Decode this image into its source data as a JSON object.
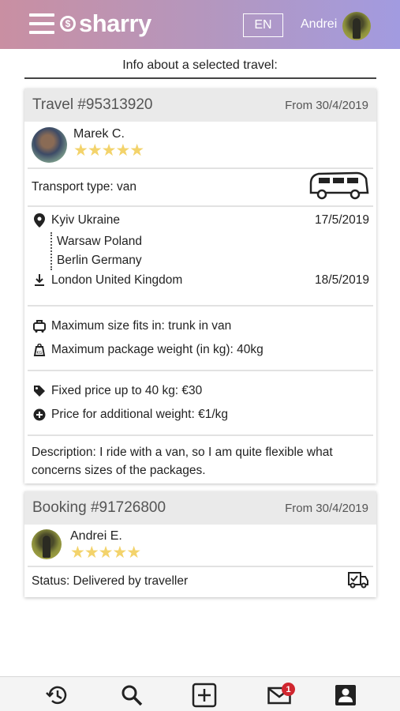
{
  "header": {
    "logo_text": "sharry",
    "lang": "EN",
    "user_name": "Andrei",
    "menu_icon": "hamburger-icon"
  },
  "subtitle": "Info about a selected travel:",
  "travel": {
    "title": "Travel #95313920",
    "date": "From 30/4/2019",
    "driver": {
      "name": "Marek C.",
      "rating": 5
    },
    "transport_label": "Transport type: van",
    "route": {
      "origin": "Kyiv Ukraine",
      "origin_date": "17/5/2019",
      "stops": [
        "Warsaw Poland",
        "Berlin Germany"
      ],
      "destination": "London United Kingdom",
      "destination_date": "18/5/2019"
    },
    "max_size": "Maximum size fits in: trunk in van",
    "max_weight": "Maximum package weight (in kg): 40kg",
    "fixed_price": "Fixed price up to 40 kg: €30",
    "additional_price": "Price for additional weight: €1/kg",
    "description": "Description: I ride with a van, so I am quite flexible what concerns sizes of the packages."
  },
  "booking": {
    "title": "Booking #91726800",
    "date": "From 30/4/2019",
    "person": {
      "name": "Andrei E.",
      "rating": 5
    },
    "status": "Status: Delivered by traveller"
  },
  "bottom_nav": {
    "items": [
      "history-icon",
      "search-icon",
      "add-icon",
      "mail-icon",
      "profile-icon"
    ],
    "mail_badge": "1"
  },
  "colors": {
    "header_start": "#c98fa2",
    "header_end": "#a29be0",
    "star": "#f3d36b",
    "badge": "#d0262f"
  }
}
